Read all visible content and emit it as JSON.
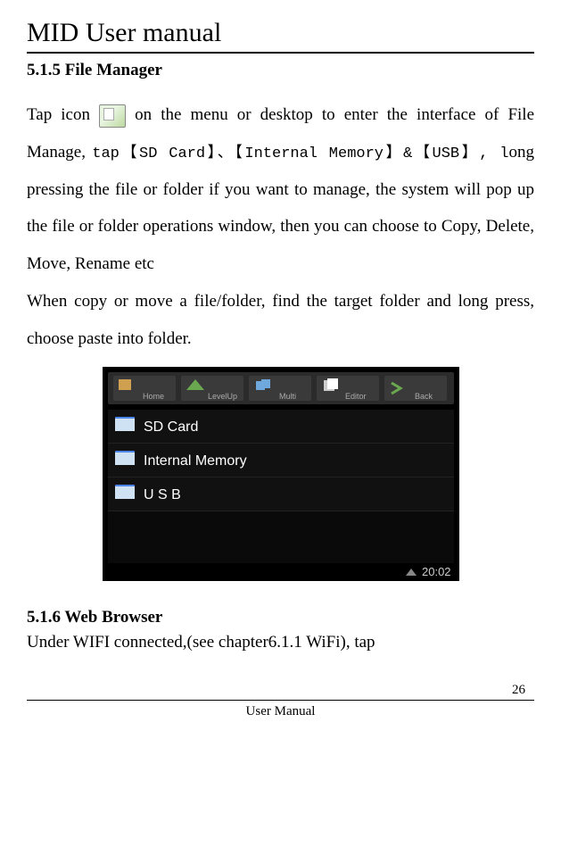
{
  "doc_title": "MID User manual",
  "section1": {
    "heading": "5.1.5 File Manager",
    "p_part1": "Tap icon ",
    "p_part2": "on the menu or desktop to enter the interface of File Manage, ",
    "p_mono1": "tap【SD Card】、【Internal Memory】&【USB】, l",
    "p_part3": "ong pressing the file or folder if you want to manage, the system will pop up the file or folder operations window, then you can choose to Copy, Delete, Move, Rename etc",
    "p2": "When copy or move a file/folder, find the target folder and long press, choose paste into folder."
  },
  "screenshot": {
    "toolbar": {
      "home": "Home",
      "levelup": "LevelUp",
      "multi": "Multi",
      "editor": "Editor",
      "back": "Back"
    },
    "items": [
      "SD Card",
      "Internal Memory",
      "U S B"
    ],
    "statusbar": {
      "time": "20:02",
      "signal": "wifi"
    }
  },
  "section2": {
    "heading": "5.1.6 Web Browser",
    "p": "Under WIFI connected,(see chapter6.1.1 WiFi), tap"
  },
  "footer": {
    "page": "26",
    "label": "User Manual"
  }
}
